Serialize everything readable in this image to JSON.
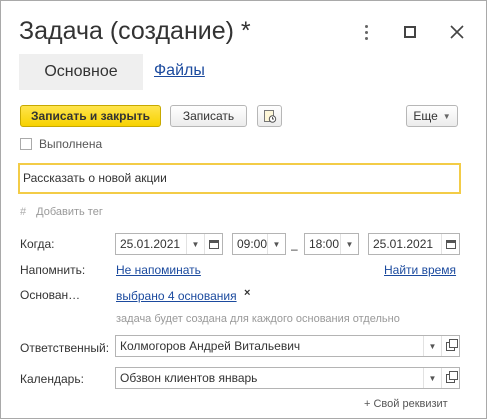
{
  "window": {
    "title": "Задача (создание) *"
  },
  "tabs": [
    {
      "label": "Основное"
    },
    {
      "label": "Файлы"
    }
  ],
  "toolbar": {
    "save_close_label": "Записать и закрыть",
    "save_label": "Записать",
    "more_label": "Еще"
  },
  "form": {
    "done_label": "Выполнена",
    "subject_value": "Рассказать о новой акции",
    "tag": {
      "hash": "#",
      "add_label": "Добавить тег"
    },
    "when": {
      "label": "Когда:",
      "start_date": "25.01.2021",
      "start_time": "09:00",
      "dash": "–",
      "end_time": "18:00",
      "end_date": "25.01.2021"
    },
    "remind": {
      "label": "Напомнить:",
      "value": "Не напоминать",
      "find_time": "Найти время"
    },
    "basis": {
      "label": "Основан…",
      "value": "выбрано 4 основания",
      "clear": "×",
      "note": "задача будет создана для каждого основания отдельно"
    },
    "responsible": {
      "label": "Ответственный:",
      "value": "Колмогоров Андрей Витальевич"
    },
    "calendar": {
      "label": "Календарь:",
      "value": "Обзвон клиентов январь"
    },
    "custom_attr": "+ Свой реквизит"
  },
  "colors": {
    "accent_button": "#f7d200",
    "link": "#1b4a9e",
    "focus_border": "#f3cc47"
  }
}
